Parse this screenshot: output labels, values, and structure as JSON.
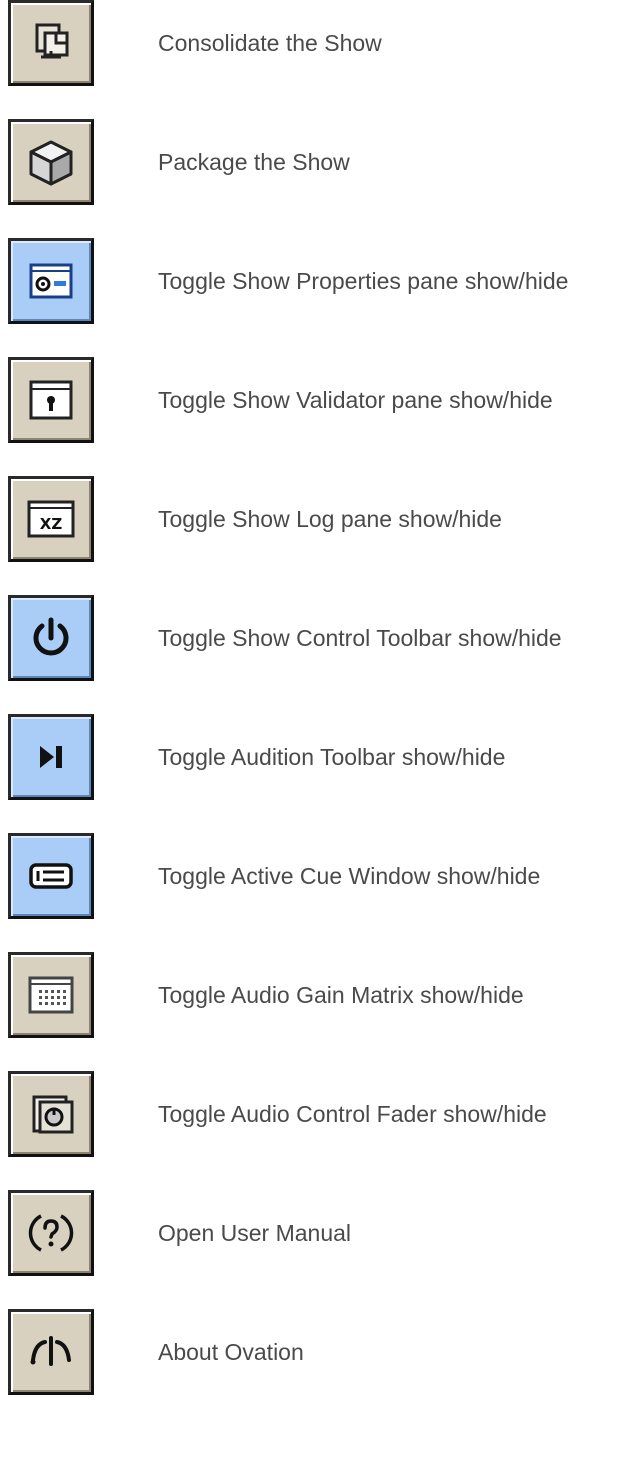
{
  "toolbar_help": {
    "items": [
      {
        "icon": "consolidate-icon",
        "label": "Consolidate the Show",
        "state": "normal"
      },
      {
        "icon": "package-box-icon",
        "label": "Package the Show",
        "state": "normal"
      },
      {
        "icon": "show-properties-pane-icon",
        "label": "Toggle Show Properties pane show/hide",
        "state": "active"
      },
      {
        "icon": "validator-pane-icon",
        "label": "Toggle Show Validator pane show/hide",
        "state": "normal"
      },
      {
        "icon": "log-pane-icon",
        "label": "Toggle Show Log pane show/hide",
        "state": "normal"
      },
      {
        "icon": "power-icon",
        "label": "Toggle Show Control Toolbar show/hide",
        "state": "active"
      },
      {
        "icon": "play-next-icon",
        "label": "Toggle Audition Toolbar show/hide",
        "state": "active"
      },
      {
        "icon": "active-cue-window-icon",
        "label": "Toggle Active Cue Window show/hide",
        "state": "active"
      },
      {
        "icon": "gain-matrix-icon",
        "label": "Toggle Audio Gain Matrix show/hide",
        "state": "normal"
      },
      {
        "icon": "control-fader-icon",
        "label": "Toggle Audio Control Fader show/hide",
        "state": "normal"
      },
      {
        "icon": "help-question-icon",
        "label": "Open User Manual",
        "state": "normal"
      },
      {
        "icon": "about-ovation-icon",
        "label": "About Ovation",
        "state": "normal"
      }
    ]
  },
  "colors": {
    "button_normal": "#d9d1bf",
    "button_active": "#a9cdf6",
    "label_text": "#4a4a4a"
  }
}
